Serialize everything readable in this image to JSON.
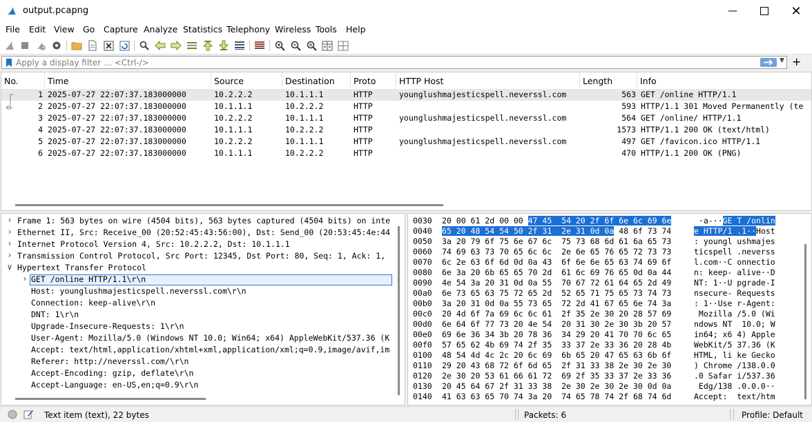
{
  "window": {
    "title": "output.pcapng"
  },
  "menu": [
    "File",
    "Edit",
    "View",
    "Go",
    "Capture",
    "Analyze",
    "Statistics",
    "Telephony",
    "Wireless",
    "Tools",
    "Help"
  ],
  "filter": {
    "placeholder": "Apply a display filter … <Ctrl-/>"
  },
  "packet_list": {
    "columns": [
      "No.",
      "Time",
      "Source",
      "Destination",
      "Proto",
      "HTTP Host",
      "Length",
      "Info"
    ],
    "rows": [
      {
        "no": "1",
        "time": "2025-07-27 22:07:37.183000000",
        "src": "10.2.2.2",
        "dst": "10.1.1.1",
        "proto": "HTTP",
        "host": "younglushmajesticspell.neverssl.com",
        "len": "563",
        "info": "GET /online HTTP/1.1"
      },
      {
        "no": "2",
        "time": "2025-07-27 22:07:37.183000000",
        "src": "10.1.1.1",
        "dst": "10.2.2.2",
        "proto": "HTTP",
        "host": "",
        "len": "593",
        "info": "HTTP/1.1 301 Moved Permanently  (te"
      },
      {
        "no": "3",
        "time": "2025-07-27 22:07:37.183000000",
        "src": "10.2.2.2",
        "dst": "10.1.1.1",
        "proto": "HTTP",
        "host": "younglushmajesticspell.neverssl.com",
        "len": "564",
        "info": "GET /online/ HTTP/1.1"
      },
      {
        "no": "4",
        "time": "2025-07-27 22:07:37.183000000",
        "src": "10.1.1.1",
        "dst": "10.2.2.2",
        "proto": "HTTP",
        "host": "",
        "len": "1573",
        "info": "HTTP/1.1 200 OK  (text/html)"
      },
      {
        "no": "5",
        "time": "2025-07-27 22:07:37.183000000",
        "src": "10.2.2.2",
        "dst": "10.1.1.1",
        "proto": "HTTP",
        "host": "younglushmajesticspell.neverssl.com",
        "len": "497",
        "info": "GET /favicon.ico HTTP/1.1"
      },
      {
        "no": "6",
        "time": "2025-07-27 22:07:37.183000000",
        "src": "10.1.1.1",
        "dst": "10.2.2.2",
        "proto": "HTTP",
        "host": "",
        "len": "470",
        "info": "HTTP/1.1 200 OK  (PNG)"
      }
    ]
  },
  "details": [
    "Frame 1: 563 bytes on wire (4504 bits), 563 bytes captured (4504 bits) on inte",
    "Ethernet II, Src: Receive_00 (20:52:45:43:56:00), Dst: Send_00 (20:53:45:4e:44",
    "Internet Protocol Version 4, Src: 10.2.2.2, Dst: 10.1.1.1",
    "Transmission Control Protocol, Src Port: 12345, Dst Port: 80, Seq: 1, Ack: 1,",
    "Hypertext Transfer Protocol",
    "GET /online HTTP/1.1\\r\\n",
    "Host: younglushmajesticspell.neverssl.com\\r\\n",
    "Connection: keep-alive\\r\\n",
    "DNT: 1\\r\\n",
    "Upgrade-Insecure-Requests: 1\\r\\n",
    "User-Agent: Mozilla/5.0 (Windows NT 10.0; Win64; x64) AppleWebKit/537.36 (K",
    "Accept: text/html,application/xhtml+xml,application/xml;q=0.9,image/avif,im",
    "Referer: http://neverssl.com/\\r\\n",
    "Accept-Encoding: gzip, deflate\\r\\n",
    "Accept-Language: en-US,en;q=0.9\\r\\n"
  ],
  "bytes": [
    {
      "off": "0030",
      "hex": "20 00 61 2d 00 00 47 45  54 20 2f 6f 6e 6c 69 6e",
      "ascii": " ·a-··GE T /onlin"
    },
    {
      "off": "0040",
      "hex": "65 20 48 54 54 50 2f 31  2e 31 0d 0a 48 6f 73 74",
      "ascii": "e HTTP/1 .1··Host"
    },
    {
      "off": "0050",
      "hex": "3a 20 79 6f 75 6e 67 6c  75 73 68 6d 61 6a 65 73",
      "ascii": ": youngl ushmajes"
    },
    {
      "off": "0060",
      "hex": "74 69 63 73 70 65 6c 6c  2e 6e 65 76 65 72 73 73",
      "ascii": "ticspell .neverss"
    },
    {
      "off": "0070",
      "hex": "6c 2e 63 6f 6d 0d 0a 43  6f 6e 6e 65 63 74 69 6f",
      "ascii": "l.com··C onnectio"
    },
    {
      "off": "0080",
      "hex": "6e 3a 20 6b 65 65 70 2d  61 6c 69 76 65 0d 0a 44",
      "ascii": "n: keep- alive··D"
    },
    {
      "off": "0090",
      "hex": "4e 54 3a 20 31 0d 0a 55  70 67 72 61 64 65 2d 49",
      "ascii": "NT: 1··U pgrade-I"
    },
    {
      "off": "00a0",
      "hex": "6e 73 65 63 75 72 65 2d  52 65 71 75 65 73 74 73",
      "ascii": "nsecure- Requests"
    },
    {
      "off": "00b0",
      "hex": "3a 20 31 0d 0a 55 73 65  72 2d 41 67 65 6e 74 3a",
      "ascii": ": 1··Use r-Agent:"
    },
    {
      "off": "00c0",
      "hex": "20 4d 6f 7a 69 6c 6c 61  2f 35 2e 30 20 28 57 69",
      "ascii": " Mozilla /5.0 (Wi"
    },
    {
      "off": "00d0",
      "hex": "6e 64 6f 77 73 20 4e 54  20 31 30 2e 30 3b 20 57",
      "ascii": "ndows NT  10.0; W"
    },
    {
      "off": "00e0",
      "hex": "69 6e 36 34 3b 20 78 36  34 29 20 41 70 70 6c 65",
      "ascii": "in64; x6 4) Apple"
    },
    {
      "off": "00f0",
      "hex": "57 65 62 4b 69 74 2f 35  33 37 2e 33 36 20 28 4b",
      "ascii": "WebKit/5 37.36 (K"
    },
    {
      "off": "0100",
      "hex": "48 54 4d 4c 2c 20 6c 69  6b 65 20 47 65 63 6b 6f",
      "ascii": "HTML, li ke Gecko"
    },
    {
      "off": "0110",
      "hex": "29 20 43 68 72 6f 6d 65  2f 31 33 38 2e 30 2e 30",
      "ascii": ") Chrome /138.0.0"
    },
    {
      "off": "0120",
      "hex": "2e 30 20 53 61 66 61 72  69 2f 35 33 37 2e 33 36",
      "ascii": ".0 Safar i/537.36"
    },
    {
      "off": "0130",
      "hex": "20 45 64 67 2f 31 33 38  2e 30 2e 30 2e 30 0d 0a",
      "ascii": " Edg/138 .0.0.0··"
    },
    {
      "off": "0140",
      "hex": "41 63 63 65 70 74 3a 20  74 65 78 74 2f 68 74 6d",
      "ascii": "Accept:  text/htm"
    }
  ],
  "status": {
    "item": "Text item (text), 22 bytes",
    "packets": "Packets: 6",
    "profile": "Profile: Default"
  },
  "colors": {
    "selection_blue": "#1c6fd4",
    "selected_row": "#e8e8e8"
  }
}
